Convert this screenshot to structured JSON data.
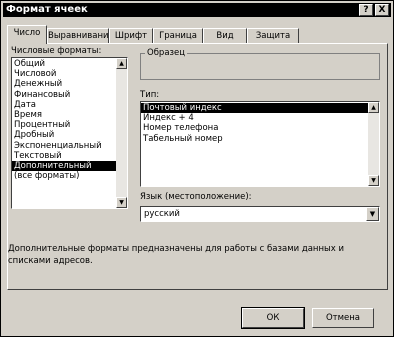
{
  "window": {
    "title": "Формат ячеек",
    "help_label": "?",
    "close_label": "X"
  },
  "tabs": [
    {
      "label": "Число",
      "active": true
    },
    {
      "label": "Выравнивание",
      "active": false
    },
    {
      "label": "Шрифт",
      "active": false
    },
    {
      "label": "Граница",
      "active": false
    },
    {
      "label": "Вид",
      "active": false
    },
    {
      "label": "Защита",
      "active": false
    }
  ],
  "formats": {
    "label": "Числовые форматы:",
    "items": [
      "Общий",
      "Числовой",
      "Денежный",
      "Финансовый",
      "Дата",
      "Время",
      "Процентный",
      "Дробный",
      "Экспоненциальный",
      "Текстовый",
      "Дополнительный",
      "(все форматы)"
    ],
    "selected": "Дополнительный"
  },
  "sample": {
    "label": "Образец"
  },
  "type": {
    "label": "Тип:",
    "items": [
      "Почтовый индекс",
      "Индекс + 4",
      "Номер телефона",
      "Табельный номер"
    ],
    "selected": "Почтовый индекс"
  },
  "language": {
    "label": "Язык (местоположение):",
    "value": "русский"
  },
  "description": "Дополнительные форматы предназначены для работы с базами данных и списками адресов.",
  "buttons": {
    "ok": "ОК",
    "cancel": "Отмена"
  },
  "icons": {
    "up": "triangle-up-icon",
    "down": "triangle-down-icon"
  }
}
